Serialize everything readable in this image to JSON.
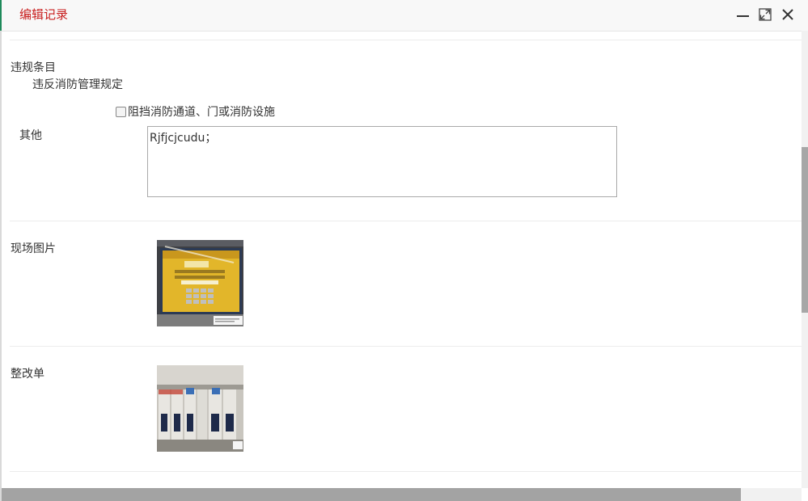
{
  "dialog": {
    "title": "编辑记录",
    "controls": {
      "minimize": "minimize-icon",
      "maximize": "maximize-icon",
      "close": "close-icon"
    }
  },
  "violation": {
    "section_label": "违规条目",
    "category": "违反消防管理规定",
    "options": [
      {
        "label": "阻挡消防通道、门或消防设施",
        "checked": false
      }
    ],
    "other_label": "其他",
    "other_value": "Rjfjcjcudu；"
  },
  "scene_photos": {
    "label": "现场图片",
    "images": [
      "photo-of-monitor-screen"
    ]
  },
  "rectification": {
    "label": "整改单",
    "images": [
      "photo-of-electrical-breaker-panel"
    ]
  },
  "colors": {
    "title": "#c81d1d",
    "accent_green": "#1f8a5b"
  }
}
